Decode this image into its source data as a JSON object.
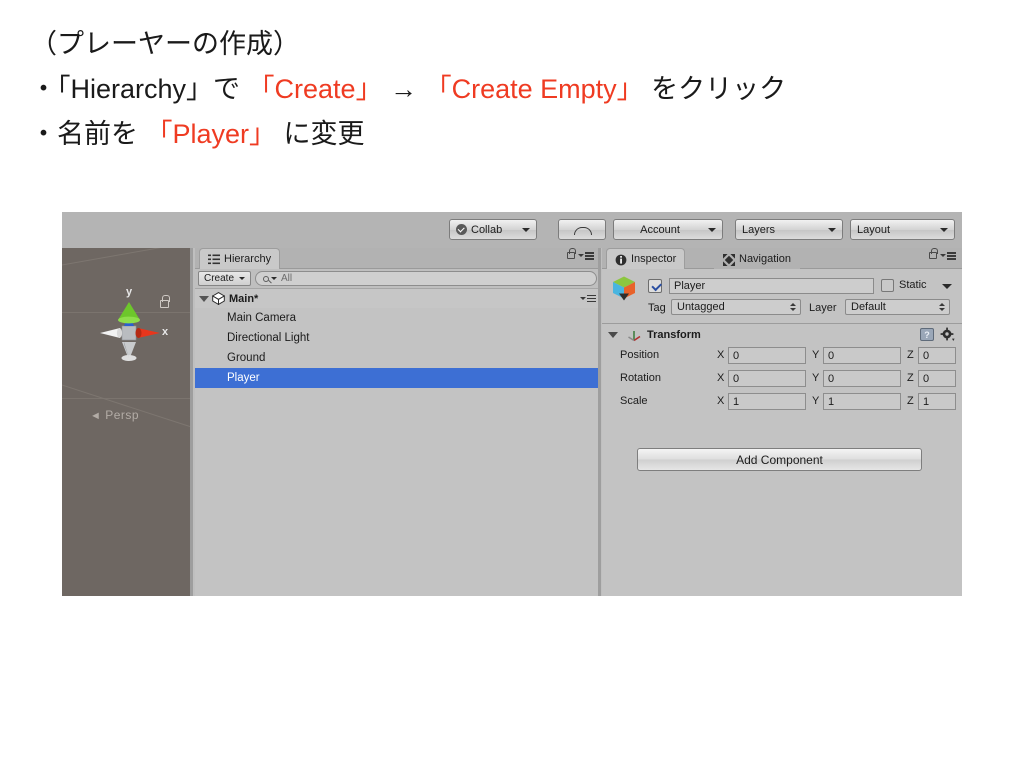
{
  "slide": {
    "lines": [
      {
        "segments": [
          {
            "text": "（プレーヤーの作成）",
            "highlight": false
          }
        ]
      },
      {
        "segments": [
          {
            "text": "・「Hierarchy」で ",
            "highlight": false
          },
          {
            "text": "「Create」",
            "highlight": true
          },
          {
            "text": " → ",
            "highlight": false
          },
          {
            "text": "「Create Empty」",
            "highlight": true
          },
          {
            "text": " をクリック",
            "highlight": false
          }
        ]
      },
      {
        "segments": [
          {
            "text": "・名前を ",
            "highlight": false
          },
          {
            "text": "「Player」",
            "highlight": true
          },
          {
            "text": " に変更",
            "highlight": false
          }
        ]
      }
    ],
    "highlight_color": "#ef3b22",
    "text_color": "#1a1a1a"
  },
  "unity": {
    "toolbar": {
      "collab_label": "Collab",
      "collab_icon": "check-circle-icon",
      "cloud_icon": "cloud-icon",
      "account_label": "Account",
      "layers_label": "Layers",
      "layout_label": "Layout"
    },
    "scene_view": {
      "gizmo_x_label": "x",
      "gizmo_y_label": "y",
      "perspective_label": "Persp",
      "perspective_arrow": "◄",
      "lock_icon": "lock-icon",
      "background_color": "#6e6762"
    },
    "hierarchy": {
      "tab_label": "Hierarchy",
      "tab_icon": "hierarchy-icon",
      "lock_icon": "lock-icon",
      "menu_icon": "panel-menu-icon",
      "create_label": "Create",
      "search_placeholder": "All",
      "search_icon": "search-icon",
      "scene_name": "Main*",
      "scene_icon": "unity-cube-icon",
      "items": [
        {
          "label": "Main Camera",
          "selected": false
        },
        {
          "label": "Directional Light",
          "selected": false
        },
        {
          "label": "Ground",
          "selected": false
        },
        {
          "label": "Player",
          "selected": true
        }
      ],
      "selection_color": "#3d6fd4"
    },
    "inspector": {
      "tab_label": "Inspector",
      "tab_icon": "info-icon",
      "navigation_tab_label": "Navigation",
      "navigation_tab_icon": "navigation-arrows-icon",
      "lock_icon": "lock-icon",
      "menu_icon": "panel-menu-icon",
      "object_icon": "prefab-cube-icon",
      "object_enabled": true,
      "object_name": "Player",
      "static_label": "Static",
      "static_checked": false,
      "tag_label": "Tag",
      "tag_value": "Untagged",
      "layer_label": "Layer",
      "layer_value": "Default",
      "transform": {
        "title": "Transform",
        "icon": "transform-axis-icon",
        "help_icon": "help-book-icon",
        "gear_icon": "gear-icon",
        "axes": [
          "X",
          "Y",
          "Z"
        ],
        "rows": [
          {
            "label": "Position",
            "values": [
              "0",
              "0",
              "0"
            ]
          },
          {
            "label": "Rotation",
            "values": [
              "0",
              "0",
              "0"
            ]
          },
          {
            "label": "Scale",
            "values": [
              "1",
              "1",
              "1"
            ]
          }
        ]
      },
      "add_component_label": "Add Component"
    }
  }
}
